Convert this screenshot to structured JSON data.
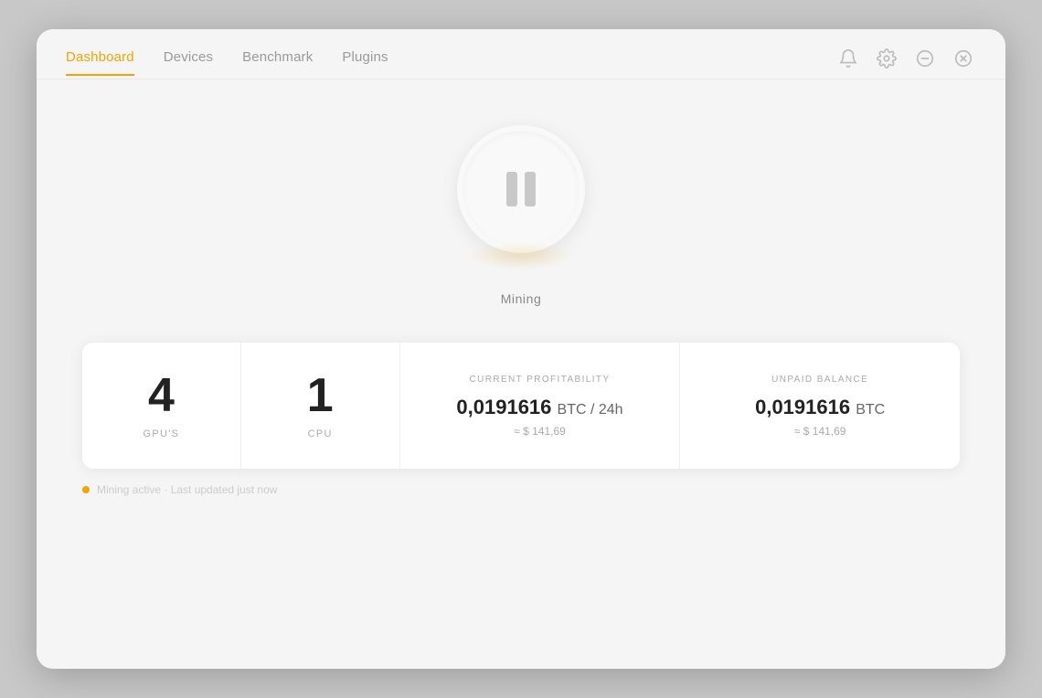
{
  "nav": {
    "items": [
      {
        "label": "Dashboard",
        "active": true
      },
      {
        "label": "Devices",
        "active": false
      },
      {
        "label": "Benchmark",
        "active": false
      },
      {
        "label": "Plugins",
        "active": false
      }
    ],
    "icons": {
      "bell": "🔔",
      "settings": "⚙",
      "minimize": "—",
      "close": "✕"
    }
  },
  "mining": {
    "status": "Mining",
    "button_state": "paused"
  },
  "stats": {
    "gpus": {
      "value": "4",
      "label": "GPU'S"
    },
    "cpu": {
      "value": "1",
      "label": "CPU"
    },
    "profitability": {
      "header": "CURRENT PROFITABILITY",
      "btc": "0,0191616",
      "unit": "BTC / 24h",
      "usd": "≈ $ 141,69"
    },
    "balance": {
      "header": "UNPAID BALANCE",
      "btc": "0,0191616",
      "unit": "BTC",
      "usd": "≈ $ 141,69"
    }
  },
  "bottom": {
    "text": "Mining active · Last updated just now"
  }
}
